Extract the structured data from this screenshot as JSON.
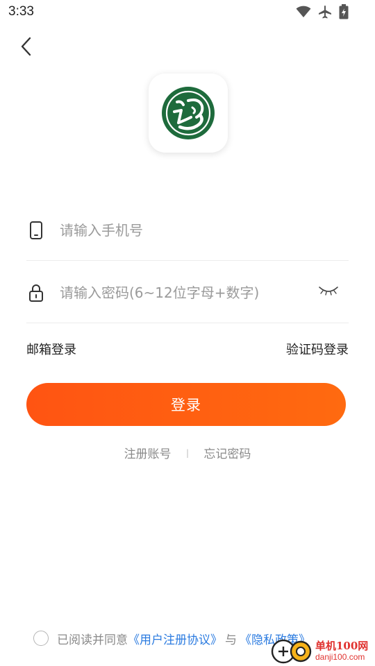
{
  "status_bar": {
    "time": "3:33",
    "icons": [
      "wifi-icon",
      "airplane-icon",
      "battery-charging-icon"
    ]
  },
  "header": {
    "back_icon": "chevron-left-icon"
  },
  "logo": {
    "brand_color": "#1e6b3c"
  },
  "form": {
    "phone": {
      "icon": "phone-icon",
      "placeholder": "请输入手机号",
      "value": ""
    },
    "password": {
      "icon": "lock-icon",
      "placeholder": "请输入密码(6~12位字母+数字)",
      "value": "",
      "toggle_icon": "eye-closed-icon"
    }
  },
  "alt_login": {
    "email": "邮箱登录",
    "code": "验证码登录"
  },
  "login_button": {
    "label": "登录",
    "color": "#ff5a0f"
  },
  "sub_links": {
    "register": "注册账号",
    "divider": "|",
    "forgot": "忘记密码"
  },
  "agreement": {
    "prefix": "已阅读并同意",
    "user_agreement": "《用户注册协议》",
    "conjunction": "与",
    "privacy_policy": "《隐私政策》",
    "checked": false,
    "link_color": "#2b7be0"
  },
  "watermark": {
    "name": "单机100网",
    "domain": "danji100.com"
  }
}
